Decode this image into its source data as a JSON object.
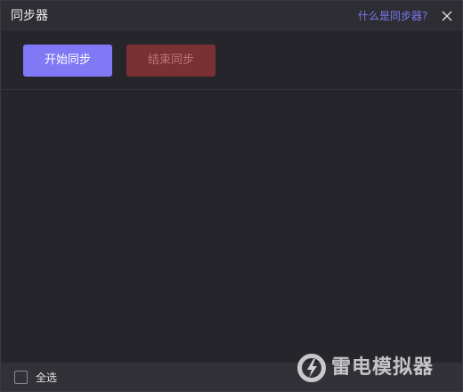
{
  "window": {
    "title": "同步器",
    "help_link": "什么是同步器?"
  },
  "toolbar": {
    "start_label": "开始同步",
    "end_label": "结束同步"
  },
  "footer": {
    "select_all_label": "全选",
    "select_all_checked": false
  },
  "watermark": {
    "text": "雷电模拟器",
    "icon": "lightning-logo-icon"
  },
  "colors": {
    "background": "#26252b",
    "titlebar": "#2e2d33",
    "accent": "#8078f5",
    "link": "#7c78f2",
    "danger_disabled": "#7a3134"
  }
}
